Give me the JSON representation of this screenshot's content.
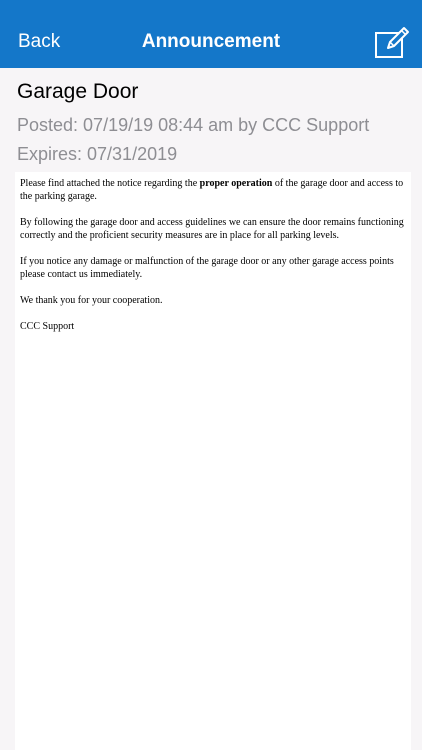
{
  "nav": {
    "back_label": "Back",
    "title": "Announcement",
    "edit_icon": "compose-icon"
  },
  "announcement": {
    "subject": "Garage Door",
    "posted": "Posted: 07/19/19 08:44 am by CCC Support",
    "expires": "Expires: 07/31/2019",
    "body": {
      "p1_before": "Please find attached the notice regarding the ",
      "p1_bold": "proper operation",
      "p1_after": " of the garage door and access to the parking garage.",
      "p2": "By following the garage door and access guidelines we can ensure the door remains functioning correctly and the proficient security measures are in place for all parking levels.",
      "p3": "If you notice any damage or malfunction of the garage door or any other garage access points please contact us immediately.",
      "p4": "We thank you for your cooperation.",
      "p5": "CCC Support"
    }
  },
  "colors": {
    "nav_background": "#1477c9",
    "secondary_text": "#8e8e93"
  }
}
